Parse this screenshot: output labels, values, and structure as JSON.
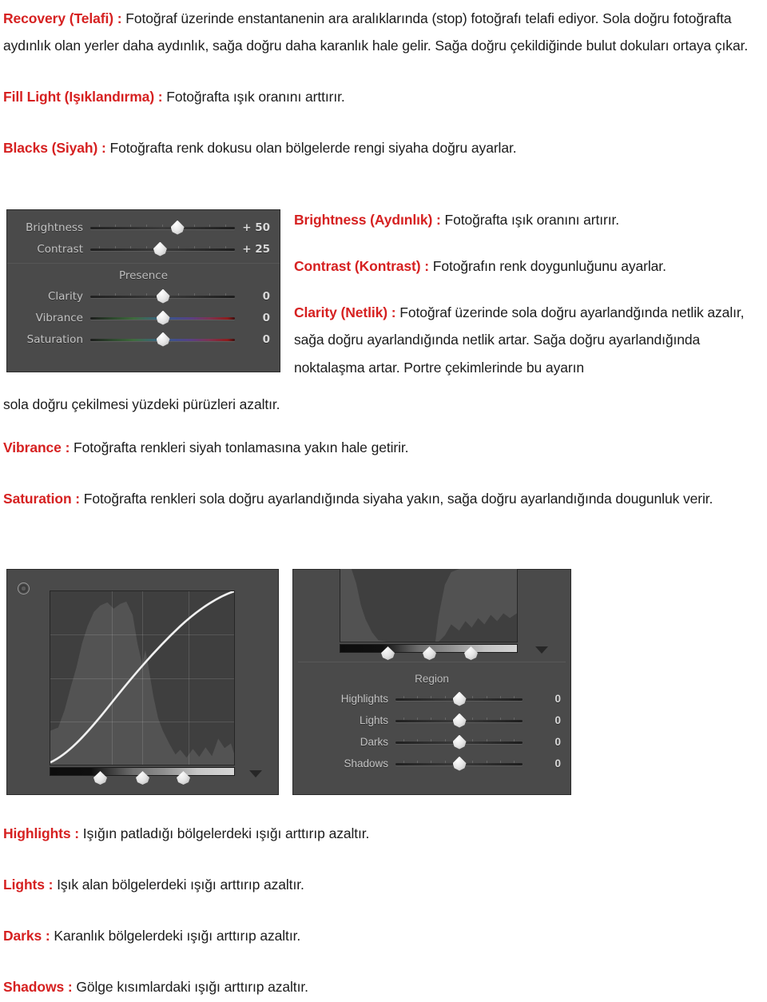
{
  "document": {
    "language": "tr",
    "accent_color": "#D62121",
    "body_color": "#1c1c1c"
  },
  "paragraphs": [
    {
      "id": "recovery",
      "term": "Recovery (Telafi) :",
      "text": " Fotoğraf üzerinde enstantanenin ara aralıklarında (stop) fotoğrafı telafi ediyor. Sola doğru fotoğrafta aydınlık olan yerler daha aydınlık, sağa doğru daha karanlık hale gelir. Sağa doğru çekildiğinde bulut dokuları ortaya çıkar."
    },
    {
      "id": "fill-light",
      "term": "Fill Light (Işıklandırma) :",
      "text": " Fotoğrafta ışık oranını arttırır."
    },
    {
      "id": "blacks",
      "term": "Blacks (Siyah) :",
      "text": " Fotoğrafta renk dokusu olan bölgelerde rengi siyaha doğru ayarlar."
    },
    {
      "id": "brightness",
      "term": "Brightness (Aydınlık) :",
      "text": " Fotoğrafta ışık oranını artırır."
    },
    {
      "id": "contrast",
      "term": "Contrast (Kontrast) :",
      "text": " Fotoğrafın renk doygunluğunu ayarlar."
    },
    {
      "id": "clarity",
      "term": "Clarity (Netlik) :",
      "text": " Fotoğraf üzerinde sola doğru ayarlandğında netlik azalır, sağa doğru ayarlandığında netlik artar.  Sağa doğru ayarlandığında noktalaşma artar. Portre çekimlerinde bu ayarın sola doğru çekilmesi yüzdeki pürüzleri azaltır."
    },
    {
      "id": "vibrance",
      "term": "Vibrance :",
      "text": " Fotoğrafta renkleri siyah tonlamasına yakın hale getirir."
    },
    {
      "id": "saturation",
      "term": "Saturation :",
      "text": " Fotoğrafta renkleri sola doğru ayarlandığında siyaha yakın, sağa doğru ayarlandığında dougunluk verir."
    },
    {
      "id": "highlights",
      "term": "Highlights :",
      "text": " Işığın patladığı bölgelerdeki ışığı arttırıp azaltır."
    },
    {
      "id": "lights",
      "term": "Lights :",
      "text": " Işık alan bölgelerdeki ışığı arttırıp azaltır."
    },
    {
      "id": "darks",
      "term": "Darks :",
      "text": " Karanlık bölgelerdeki ışığı arttırıp azaltır."
    },
    {
      "id": "shadows",
      "term": "Shadows :",
      "text": " Gölge kısımlardaki ışığı arttırıp azaltır."
    }
  ],
  "basic_panel": {
    "sliders": [
      {
        "label": "Brightness",
        "value": "+ 50",
        "pos": 60,
        "track": "plain"
      },
      {
        "label": "Contrast",
        "value": "+ 25",
        "pos": 48,
        "track": "plain"
      }
    ],
    "section_title": "Presence",
    "presence_sliders": [
      {
        "label": "Clarity",
        "value": "0",
        "pos": 50,
        "track": "plain"
      },
      {
        "label": "Vibrance",
        "value": "0",
        "pos": 50,
        "track": "rainbow"
      },
      {
        "label": "Saturation",
        "value": "0",
        "pos": 50,
        "track": "rainbow"
      }
    ]
  },
  "tone_curve_panel": {
    "target_icon": "targeted-adjustment-icon",
    "split_thumbs": [
      27,
      50,
      72
    ],
    "disclosure_icon": "triangle-down-icon"
  },
  "region_panel": {
    "section_title": "Region",
    "split_thumbs": [
      27,
      50,
      72
    ],
    "disclosure_icon": "triangle-down-icon",
    "sliders": [
      {
        "label": "Highlights",
        "value": "0",
        "pos": 50
      },
      {
        "label": "Lights",
        "value": "0",
        "pos": 50
      },
      {
        "label": "Darks",
        "value": "0",
        "pos": 50
      },
      {
        "label": "Shadows",
        "value": "0",
        "pos": 50
      }
    ]
  }
}
